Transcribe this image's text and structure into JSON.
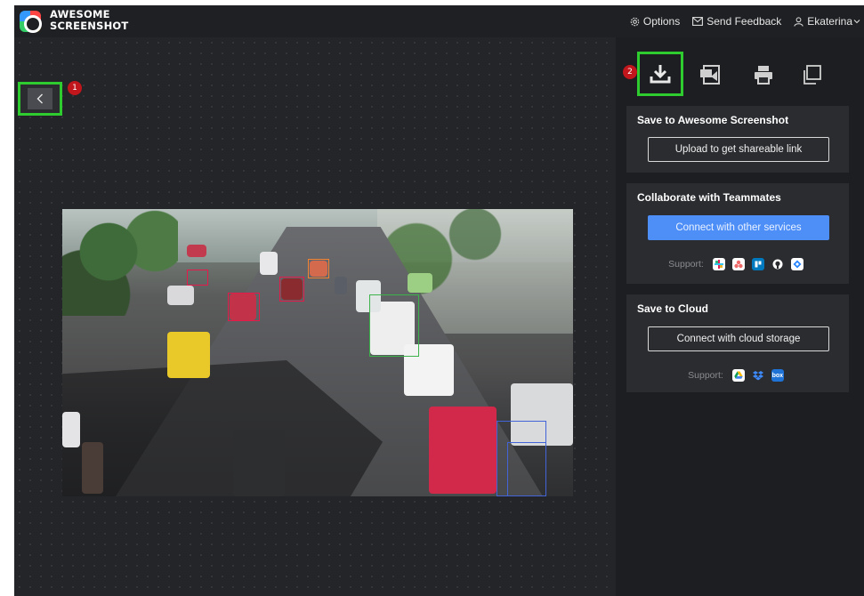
{
  "app": {
    "logo_line1": "AWESOME",
    "logo_line2": "SCREENSHOT"
  },
  "header": {
    "options": "Options",
    "feedback": "Send Feedback",
    "user": "Ekaterina"
  },
  "canvas": {
    "badge_1": "1"
  },
  "toolbar": {
    "badge_2": "2"
  },
  "save_card": {
    "title": "Save to Awesome Screenshot",
    "button": "Upload to get shareable link"
  },
  "collab_card": {
    "title": "Collaborate with Teammates",
    "button": "Connect with other services",
    "support_label": "Support:",
    "services": [
      "slack-icon",
      "asana-icon",
      "trello-icon",
      "github-icon",
      "jira-icon"
    ]
  },
  "cloud_card": {
    "title": "Save to Cloud",
    "button": "Connect with cloud storage",
    "support_label": "Support:",
    "services": [
      "google-drive-icon",
      "dropbox-icon",
      "box-icon"
    ],
    "box_text": "box"
  },
  "colors": {
    "accent": "#4d8ef7",
    "highlight": "#2ecc2e",
    "badge": "#c0161c"
  }
}
